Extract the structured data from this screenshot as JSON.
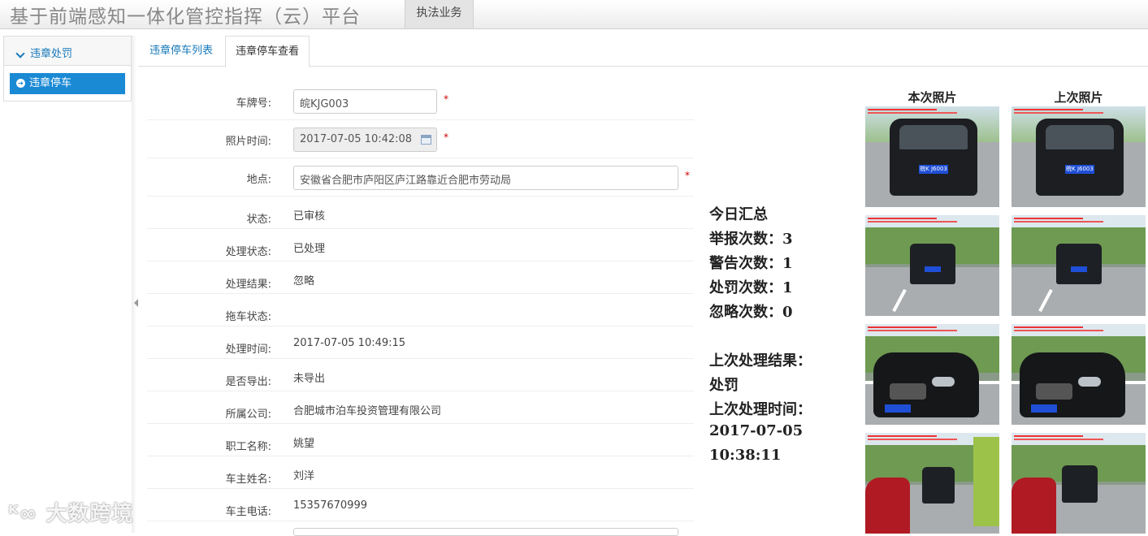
{
  "header": {
    "app_title": "基于前端感知一体化管控指挥（云）平台",
    "top_tab": "执法业务"
  },
  "sidebar": {
    "group_label": "违章处罚",
    "items": [
      {
        "label": "违章停车"
      }
    ]
  },
  "tabs": [
    {
      "label": "违章停车列表",
      "active": false
    },
    {
      "label": "违章停车查看",
      "active": true
    }
  ],
  "form": {
    "plate": {
      "label": "车牌号:",
      "value": "皖KJG003"
    },
    "photo_time": {
      "label": "照片时间:",
      "value": "2017-07-05 10:42:08"
    },
    "location": {
      "label": "地点:",
      "value": "安徽省合肥市庐阳区庐江路靠近合肥市劳动局"
    },
    "required_mark": "*",
    "fields": [
      {
        "label": "状态:",
        "value": "已审核"
      },
      {
        "label": "处理状态:",
        "value": "已处理"
      },
      {
        "label": "处理结果:",
        "value": "忽略"
      },
      {
        "label": "拖车状态:",
        "value": ""
      },
      {
        "label": "处理时间:",
        "value": "2017-07-05 10:49:15"
      },
      {
        "label": "是否导出:",
        "value": "未导出"
      },
      {
        "label": "所属公司:",
        "value": "合肥城市泊车投资管理有限公司"
      },
      {
        "label": "职工名称:",
        "value": "姚望"
      },
      {
        "label": "车主姓名:",
        "value": "刘洋"
      },
      {
        "label": "车主电话:",
        "value": "15357670999"
      }
    ]
  },
  "summary": {
    "title": "今日汇总",
    "report": "举报次数：3",
    "warning": "警告次数：1",
    "penalty": "处罚次数：1",
    "ignored": "忽略次数：0",
    "last_result_label": "上次处理结果：",
    "last_result": "处罚",
    "last_time_label": "上次处理时间：",
    "last_date": "2017-07-05",
    "last_time": "10:38:11"
  },
  "photos": {
    "current_label": "本次照片",
    "previous_label": "上次照片",
    "plate_text": "皖K J6003"
  },
  "watermark": "大数跨境"
}
